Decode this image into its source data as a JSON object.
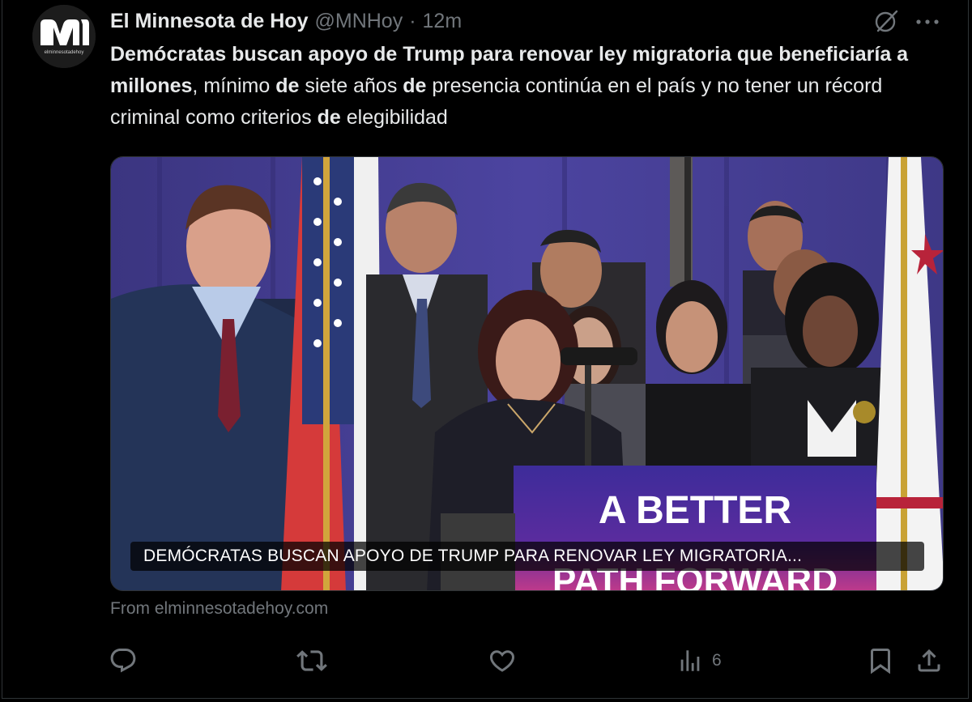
{
  "account": {
    "name": "El Minnesota de Hoy",
    "handle": "@MNHoy",
    "separator": "·",
    "time": "12m",
    "avatar_caption": "elminnesotadehoy"
  },
  "tweet": {
    "segments": [
      {
        "text": "Demócratas buscan apoyo de Trump para renovar ley migratoria que beneficiaría a millones",
        "bold": true
      },
      {
        "text": ", mínimo ",
        "bold": false
      },
      {
        "text": "de",
        "bold": true
      },
      {
        "text": " siete años ",
        "bold": false
      },
      {
        "text": "de",
        "bold": true
      },
      {
        "text": " presencia continúa en el país y no tener un récord criminal como criterios ",
        "bold": false
      },
      {
        "text": "de",
        "bold": true
      },
      {
        "text": " elegibilidad",
        "bold": false
      }
    ]
  },
  "card": {
    "caption": "DEMÓCRATAS BUSCAN APOYO DE TRUMP PARA RENOVAR LEY MIGRATORIA...",
    "podium_line1": "A BETTER",
    "podium_line2": "PATH FORWARD",
    "source": "From elminnesotadehoy.com"
  },
  "actions": {
    "reply_icon": "reply-icon",
    "retweet_icon": "retweet-icon",
    "like_icon": "like-icon",
    "views_icon": "views-icon",
    "views_count": "6",
    "bookmark_icon": "bookmark-icon",
    "share_icon": "share-icon"
  },
  "colors": {
    "background": "#000000",
    "text": "#e7e9ea",
    "muted": "#71767b",
    "border": "#2f3336"
  }
}
